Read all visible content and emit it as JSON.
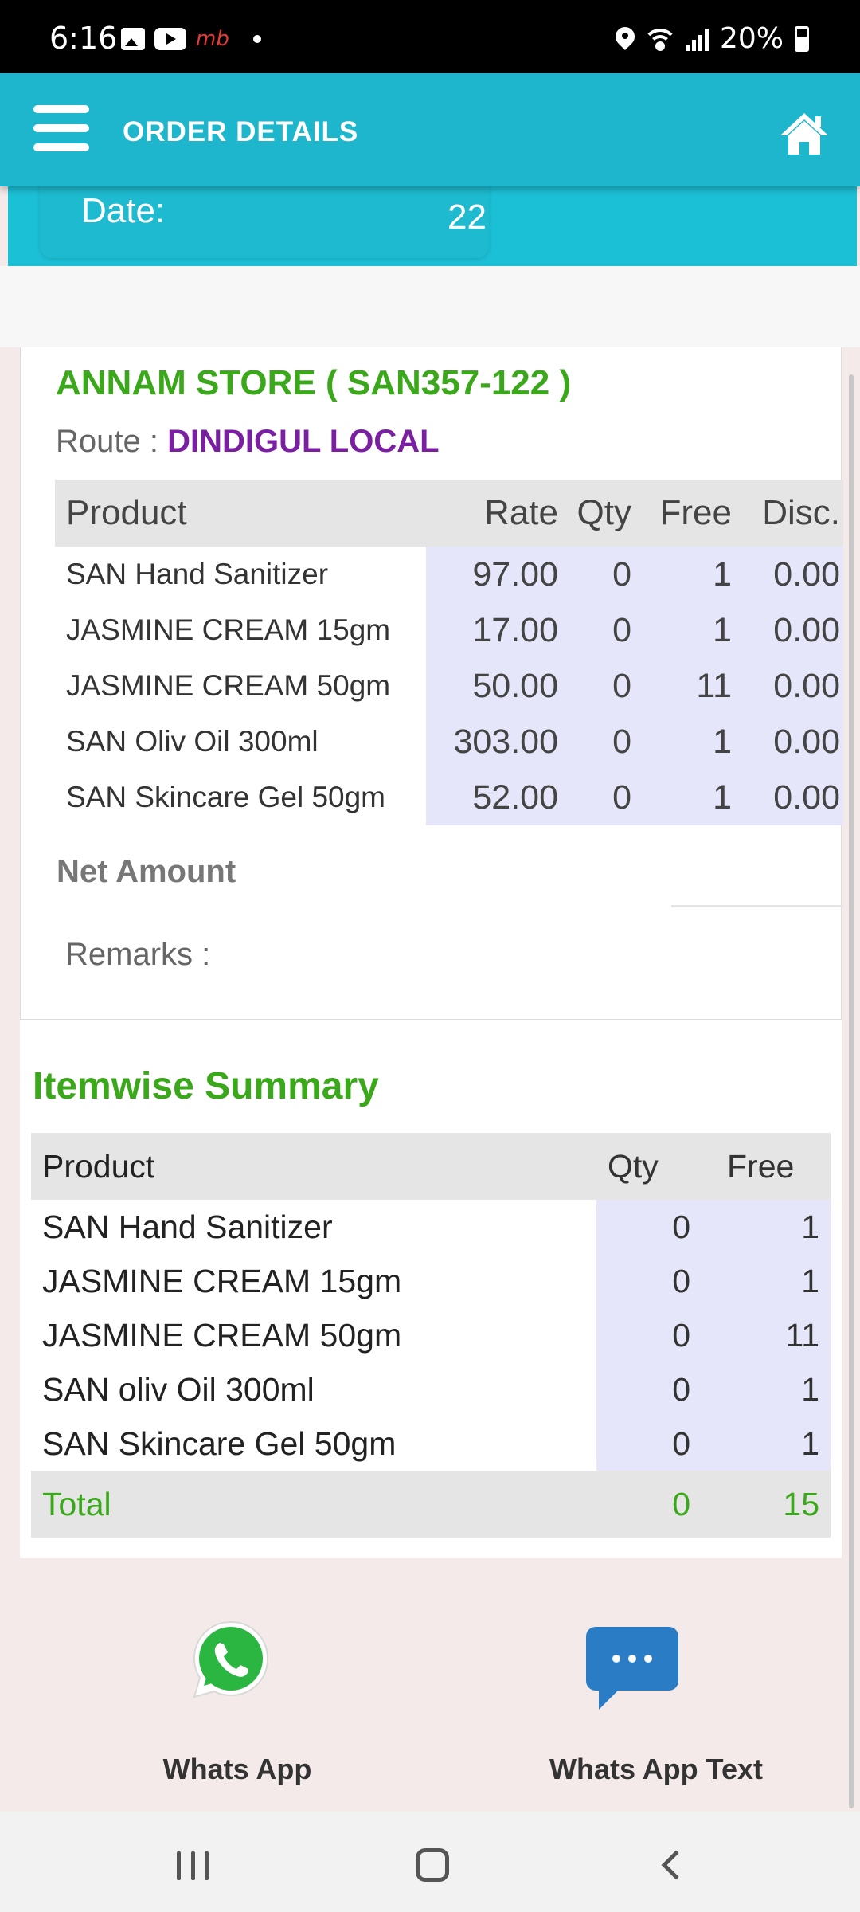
{
  "status_bar": {
    "time": "6:16",
    "carrier_badge": "mb",
    "battery": "20%"
  },
  "header": {
    "title": "ORDER DETAILS"
  },
  "date": {
    "label": "Date:",
    "value": "22"
  },
  "order": {
    "store": "ANNAM STORE ( SAN357-122 )",
    "route_label": "Route : ",
    "route_value": "DINDIGUL LOCAL",
    "columns": [
      "Product",
      "Rate",
      "Qty",
      "Free",
      "Disc."
    ],
    "rows": [
      {
        "product": "SAN Hand Sanitizer",
        "rate": "97.00",
        "qty": "0",
        "free": "1",
        "disc": "0.00"
      },
      {
        "product": "JASMINE CREAM 15gm",
        "rate": "17.00",
        "qty": "0",
        "free": "1",
        "disc": "0.00"
      },
      {
        "product": "JASMINE CREAM 50gm",
        "rate": "50.00",
        "qty": "0",
        "free": "11",
        "disc": "0.00"
      },
      {
        "product": "SAN Oliv Oil 300ml",
        "rate": "303.00",
        "qty": "0",
        "free": "1",
        "disc": "0.00"
      },
      {
        "product": "SAN Skincare Gel 50gm",
        "rate": "52.00",
        "qty": "0",
        "free": "1",
        "disc": "0.00"
      }
    ],
    "net_amount_label": "Net Amount",
    "remarks_label": "Remarks :"
  },
  "summary": {
    "title": "Itemwise Summary",
    "columns": [
      "Product",
      "Qty",
      "Free"
    ],
    "rows": [
      {
        "product": "SAN Hand Sanitizer",
        "qty": "0",
        "free": "1"
      },
      {
        "product": "JASMINE CREAM 15gm",
        "qty": "0",
        "free": "1"
      },
      {
        "product": "JASMINE CREAM 50gm",
        "qty": "0",
        "free": "11"
      },
      {
        "product": "SAN oliv Oil 300ml",
        "qty": "0",
        "free": "1"
      },
      {
        "product": "SAN Skincare Gel 50gm",
        "qty": "0",
        "free": "1"
      }
    ],
    "total": {
      "label": "Total",
      "qty": "0",
      "free": "15"
    }
  },
  "share": {
    "whatsapp_label": "Whats App",
    "whatsapp_text_label": "Whats App Text"
  },
  "colors": {
    "header": "#1eb6cc",
    "green": "#3aa81a",
    "purple": "#7b1fa2",
    "cell_highlight": "#e6e6fa"
  },
  "icons": {
    "menu": "menu-icon",
    "home": "home-icon",
    "whatsapp": "whatsapp-icon",
    "chat": "chat-bubble-icon"
  }
}
